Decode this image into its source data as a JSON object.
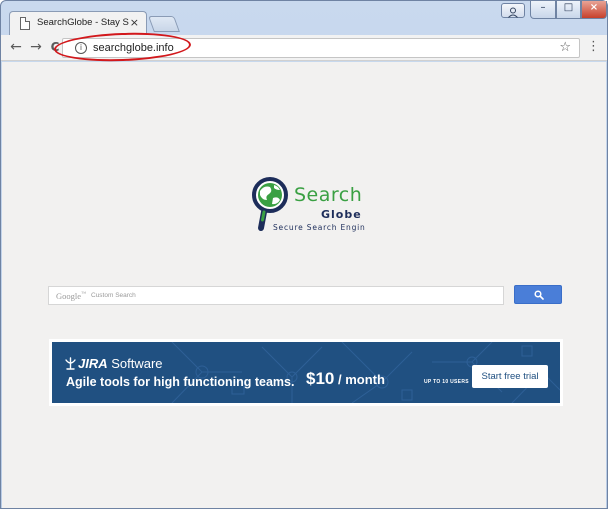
{
  "browser": {
    "tab": {
      "title": "SearchGlobe - Stay Secu",
      "close_glyph": "×"
    },
    "window_controls": {
      "minimize": "–",
      "maximize": "□",
      "close": "×"
    },
    "address_bar": {
      "url": "searchglobe.info"
    },
    "icons": {
      "back": "back-arrow-icon",
      "forward": "forward-arrow-icon",
      "reload": "reload-icon",
      "info": "info-icon",
      "bookmark": "star-icon",
      "menu": "kebab-menu-icon"
    },
    "glyphs": {
      "back": "←",
      "forward": "→",
      "reload": "C",
      "info": "i",
      "star": "☆",
      "menu": "⋮"
    },
    "annotation_color": "#d2181c"
  },
  "page": {
    "background": "#f2f1f0",
    "logo": {
      "word1": "Search",
      "word2": "Globe",
      "tagline": "Secure Search Engin",
      "colors": {
        "green": "#3aa043",
        "navy": "#1d2d5a"
      }
    },
    "search": {
      "brand": "Google",
      "brand_tm": "™",
      "placeholder": "Custom Search",
      "button_color": "#4a7ed8"
    },
    "ad": {
      "brand_prefix": "JIRA",
      "brand_suffix": " Software",
      "headline": "Agile tools for high functioning teams.",
      "price": "$10",
      "price_unit": " / month",
      "price_note": "UP TO 10 USERS",
      "cta": "Start free trial",
      "background": "#205081"
    }
  }
}
